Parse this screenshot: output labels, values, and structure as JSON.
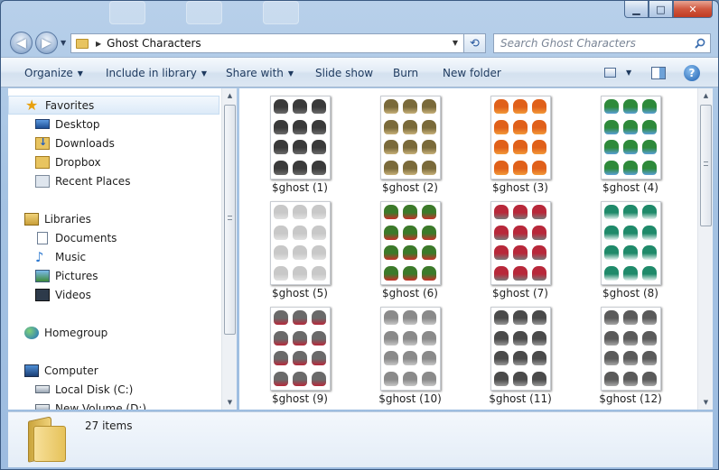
{
  "window": {
    "caption_min": "▁",
    "caption_max": "□",
    "caption_close": "✕"
  },
  "address": {
    "path_label": "Ghost Characters",
    "back_glyph": "◀",
    "forward_glyph": "▶",
    "separator_glyph": "▶",
    "dropdown_glyph": "▼",
    "refresh_glyph": "⟲"
  },
  "search": {
    "placeholder": "Search Ghost Characters"
  },
  "toolbar": {
    "organize": "Organize",
    "include_in_library": "Include in library",
    "share_with": "Share with",
    "slide_show": "Slide show",
    "burn": "Burn",
    "new_folder": "New folder",
    "dropdown_glyph": "▼",
    "help_glyph": "?"
  },
  "sidebar": {
    "items": [
      {
        "label": "Favorites",
        "icon": "star-icon",
        "level": 0,
        "selected": true
      },
      {
        "label": "Desktop",
        "icon": "desktop-icon",
        "level": 1
      },
      {
        "label": "Downloads",
        "icon": "downloads-folder-icon",
        "level": 1
      },
      {
        "label": "Dropbox",
        "icon": "folder-icon",
        "level": 1
      },
      {
        "label": "Recent Places",
        "icon": "recent-places-icon",
        "level": 1
      },
      {
        "label": "Libraries",
        "icon": "libraries-icon",
        "level": 0
      },
      {
        "label": "Documents",
        "icon": "documents-icon",
        "level": 1
      },
      {
        "label": "Music",
        "icon": "music-icon",
        "level": 1
      },
      {
        "label": "Pictures",
        "icon": "pictures-icon",
        "level": 1
      },
      {
        "label": "Videos",
        "icon": "videos-icon",
        "level": 1
      },
      {
        "label": "Homegroup",
        "icon": "homegroup-icon",
        "level": 0
      },
      {
        "label": "Computer",
        "icon": "computer-icon",
        "level": 0
      },
      {
        "label": "Local Disk (C:)",
        "icon": "drive-icon",
        "level": 1
      },
      {
        "label": "New Volume (D:)",
        "icon": "drive-icon",
        "level": 1
      }
    ]
  },
  "files": [
    {
      "name": "$ghost (1)",
      "colors": [
        "#3a3a3a",
        "#6b6b6b"
      ]
    },
    {
      "name": "$ghost (2)",
      "colors": [
        "#7a6a3a",
        "#c9b27a"
      ]
    },
    {
      "name": "$ghost (3)",
      "colors": [
        "#e0601a",
        "#f39a3a"
      ]
    },
    {
      "name": "$ghost (4)",
      "colors": [
        "#2e8a3a",
        "#5aa0d8"
      ]
    },
    {
      "name": "$ghost (5)",
      "colors": [
        "#c8c8c8",
        "#e2e2e2"
      ]
    },
    {
      "name": "$ghost (6)",
      "colors": [
        "#3c7a2a",
        "#c8302a"
      ]
    },
    {
      "name": "$ghost (7)",
      "colors": [
        "#b8283a",
        "#7a7a7a"
      ]
    },
    {
      "name": "$ghost (8)",
      "colors": [
        "#1f8a6a",
        "#e6f2f0"
      ]
    },
    {
      "name": "$ghost (9)",
      "colors": [
        "#6a6a6a",
        "#b8283a"
      ]
    },
    {
      "name": "$ghost (10)",
      "colors": [
        "#8a8a8a",
        "#c8c8c8"
      ]
    },
    {
      "name": "$ghost (11)",
      "colors": [
        "#4a4a4a",
        "#9a9a9a"
      ]
    },
    {
      "name": "$ghost (12)",
      "colors": [
        "#5a5a5a",
        "#a8a8a8"
      ]
    }
  ],
  "details": {
    "item_count": "27 items"
  },
  "scrollbar": {
    "up_glyph": "▲",
    "down_glyph": "▼"
  }
}
